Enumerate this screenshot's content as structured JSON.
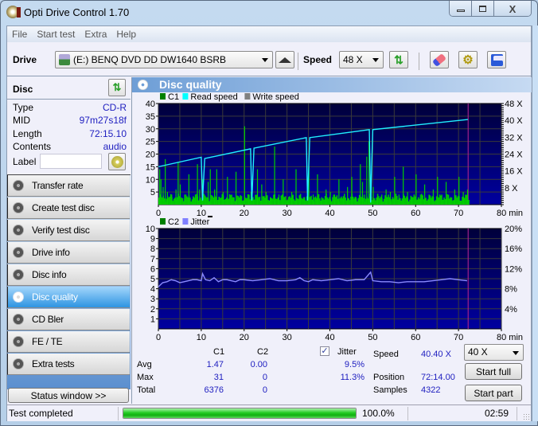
{
  "window": {
    "title": "Opti Drive Control 1.70",
    "minimize": "—",
    "maximize": "□",
    "close": "X"
  },
  "menu": [
    "File",
    "Start test",
    "Extra",
    "Help"
  ],
  "toolbar": {
    "drive_label": "Drive",
    "drive_value": "(E:)  BENQ DVD DD DW1640 BSRB",
    "speed_label": "Speed",
    "speed_value": "48 X"
  },
  "disc": {
    "header": "Disc",
    "rows": [
      {
        "key": "Type",
        "value": "CD-R"
      },
      {
        "key": "MID",
        "value": "97m27s18f"
      },
      {
        "key": "Length",
        "value": "72:15.10"
      },
      {
        "key": "Contents",
        "value": "audio"
      }
    ],
    "label_key": "Label",
    "label_value": ""
  },
  "nav": [
    {
      "label": "Transfer rate",
      "active": false
    },
    {
      "label": "Create test disc",
      "active": false
    },
    {
      "label": "Verify test disc",
      "active": false
    },
    {
      "label": "Drive info",
      "active": false
    },
    {
      "label": "Disc info",
      "active": false
    },
    {
      "label": "Disc quality",
      "active": true
    },
    {
      "label": "CD Bler",
      "active": false
    },
    {
      "label": "FE / TE",
      "active": false
    },
    {
      "label": "Extra tests",
      "active": false
    }
  ],
  "status_window_button": "Status window >>",
  "panel_title": "Disc quality",
  "stats": {
    "col_c1": "C1",
    "col_c2": "C2",
    "jitter_label": "Jitter",
    "jitter_checked": true,
    "avg_label": "Avg",
    "max_label": "Max",
    "total_label": "Total",
    "avg_c1": "1.47",
    "avg_c2": "0.00",
    "avg_jitter": "9.5%",
    "max_c1": "31",
    "max_c2": "0",
    "max_jitter": "11.3%",
    "total_c1": "6376",
    "total_c2": "0",
    "speed_label": "Speed",
    "speed_value": "40.40 X",
    "position_label": "Position",
    "position_value": "72:14.00",
    "samples_label": "Samples",
    "samples_value": "4322",
    "speed_select": "40 X",
    "start_full": "Start full",
    "start_part": "Start part"
  },
  "statusbar": {
    "text": "Test completed",
    "progress": 100.0,
    "progress_text": "100.0%",
    "time": "02:59"
  },
  "chart_data": [
    {
      "type": "bar",
      "title": "C1 / Read speed",
      "legend": [
        "C1",
        "Read speed",
        "Write speed"
      ],
      "legend_colors": [
        "#008000",
        "#00ffff",
        "#808080"
      ],
      "xlabel": "min",
      "xlim": [
        0,
        80
      ],
      "xticks": [
        0,
        10,
        20,
        30,
        40,
        50,
        60,
        70,
        80
      ],
      "ylim_left": [
        0,
        40
      ],
      "yticks_left": [
        5,
        10,
        15,
        20,
        25,
        30,
        35,
        40
      ],
      "ylim_right": [
        0,
        48
      ],
      "yticks_right_labels": [
        "8 X",
        "16 X",
        "24 X",
        "32 X",
        "40 X",
        "48 X"
      ],
      "end_marker_min": 72.25,
      "c1_series": {
        "note": "approximate C1 errors per sample (selected peaks)",
        "x": [
          0.2,
          0.5,
          1,
          1.5,
          2,
          3,
          4,
          4.5,
          5,
          6,
          7,
          8,
          8.5,
          9,
          9.5,
          10.2,
          11,
          11.5,
          12,
          13,
          13.5,
          14,
          15,
          16,
          17,
          18,
          19,
          20,
          21,
          21.5,
          22,
          23,
          24,
          25,
          26,
          27,
          28,
          29,
          30,
          31,
          32,
          33,
          34,
          35,
          36,
          37,
          38,
          39,
          40,
          41,
          42,
          43,
          44,
          45,
          46,
          47,
          47.5,
          48,
          48.5,
          49,
          49.5,
          50,
          51,
          52,
          53,
          54,
          55,
          56,
          57,
          58,
          59,
          60,
          61,
          62,
          63,
          64,
          65,
          66,
          67,
          68,
          69,
          70,
          71,
          72
        ],
        "values": [
          14,
          10,
          7,
          18,
          5,
          4,
          6,
          17,
          8,
          4,
          12,
          3,
          4,
          16,
          6,
          10,
          3,
          9,
          14,
          6,
          14,
          3,
          5,
          11,
          4,
          13,
          3,
          31,
          4,
          5,
          3,
          14,
          8,
          5,
          3,
          23,
          4,
          10,
          2,
          5,
          14,
          4,
          3,
          15,
          4,
          12,
          3,
          6,
          5,
          4,
          10,
          2,
          7,
          11,
          3,
          16,
          9,
          4,
          19,
          25,
          12,
          7,
          3,
          4,
          6,
          5,
          11,
          4,
          15,
          5,
          3,
          12,
          4,
          8,
          3,
          6,
          11,
          4,
          9,
          3,
          6,
          11,
          5,
          6
        ]
      },
      "read_speed_series": {
        "unit": "X",
        "x": [
          0,
          10,
          10.3,
          10.8,
          21.5,
          21.8,
          22.3,
          34.5,
          34.8,
          35.3,
          49.2,
          49.5,
          50,
          72.2
        ],
        "values": [
          18.0,
          22.5,
          2,
          21.9,
          26.5,
          2,
          26.8,
          31.8,
          2,
          31.8,
          35.6,
          1,
          35.6,
          40.4
        ]
      }
    },
    {
      "type": "line",
      "title": "C2 / Jitter",
      "legend": [
        "C2",
        "Jitter"
      ],
      "legend_colors": [
        "#008000",
        "#8080ff"
      ],
      "xlabel": "min",
      "xlim": [
        0,
        80
      ],
      "xticks": [
        0,
        10,
        20,
        30,
        40,
        50,
        60,
        70,
        80
      ],
      "ylim_left": [
        0,
        10
      ],
      "yticks_left": [
        1,
        2,
        3,
        4,
        5,
        6,
        7,
        8,
        9,
        10
      ],
      "ylim_right": [
        0,
        20
      ],
      "yticks_right_labels": [
        "4%",
        "8%",
        "12%",
        "16%",
        "20%"
      ],
      "end_marker_min": 72.25,
      "c2_values": "all 0",
      "jitter_series": {
        "unit": "%",
        "x": [
          0,
          1,
          2,
          3,
          4,
          5,
          6,
          7,
          8,
          9,
          10,
          10.3,
          11,
          12,
          13,
          14,
          15,
          16,
          17,
          18,
          19,
          20,
          22,
          24,
          26,
          28,
          30,
          32,
          33,
          34,
          35,
          36,
          38,
          40,
          42,
          44,
          46,
          48,
          49.5,
          50,
          52,
          54,
          56,
          58,
          60,
          62,
          64,
          66,
          68,
          70,
          72
        ],
        "values": [
          8.4,
          9.2,
          9.4,
          9.8,
          9.6,
          9.2,
          9.4,
          9.6,
          9.8,
          9.8,
          9.6,
          11.0,
          9.8,
          9.6,
          10.2,
          9.4,
          9.8,
          9.8,
          9.6,
          9.4,
          9.8,
          9.8,
          9.6,
          9.8,
          10.0,
          9.6,
          9.6,
          9.8,
          10.2,
          9.6,
          9.4,
          9.8,
          9.6,
          9.8,
          10.0,
          9.6,
          9.8,
          9.8,
          11.3,
          9.6,
          9.4,
          9.4,
          9.2,
          9.4,
          9.4,
          9.4,
          9.6,
          9.8,
          10.0,
          9.8,
          9.6
        ]
      }
    }
  ]
}
